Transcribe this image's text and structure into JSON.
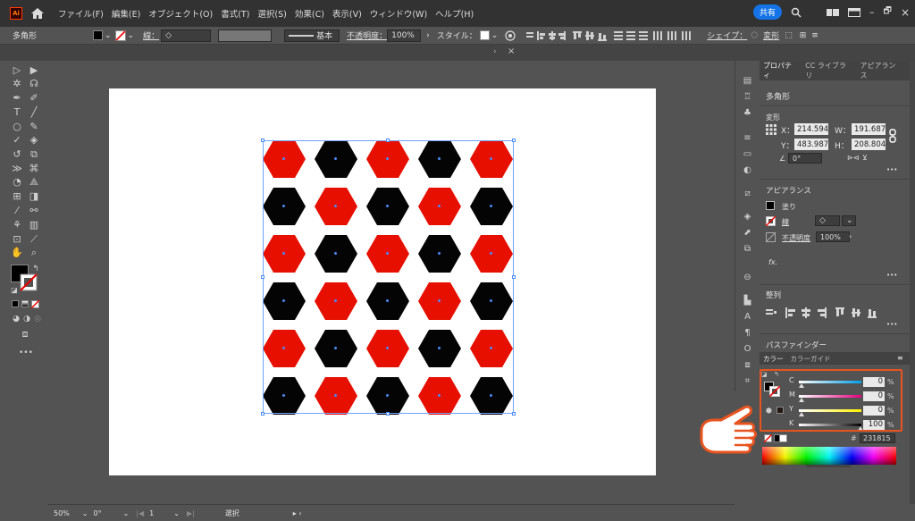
{
  "menubar": {
    "app_icon": "Ai",
    "items": [
      "ファイル(F)",
      "編集(E)",
      "オブジェクト(O)",
      "書式(T)",
      "選択(S)",
      "効果(C)",
      "表示(V)",
      "ウィンドウ(W)",
      "ヘルプ(H)"
    ],
    "share_label": "共有",
    "win_minimize": "–",
    "win_restore": "🗗",
    "win_close": "×"
  },
  "control_bar": {
    "object_type": "多角形",
    "stroke_label": "線：",
    "stroke_style": "基本",
    "opacity_label": "不透明度：",
    "opacity_value": "100%",
    "style_label": "スタイル：",
    "shape_label": "シェイプ：",
    "transform_label": "変形"
  },
  "tab_close": "×",
  "properties_panel": {
    "tabs": [
      "プロパティ",
      "CC ライブラリ",
      "アピアランス"
    ],
    "object_type": "多角形",
    "transform_heading": "変形",
    "x_label": "X：",
    "x_value": "214.594",
    "y_label": "Y：",
    "y_value": "483.987",
    "w_label": "W：",
    "w_value": "191.687",
    "h_label": "H：",
    "h_value": "208.804",
    "angle_value": "0°",
    "appearance_heading": "アピアランス",
    "fill_label": "塗り",
    "stroke_label": "線",
    "opacity_label": "不透明度",
    "opacity_value": "100%",
    "fx_label": "fx.",
    "align_heading": "整列",
    "pathfinder_heading": "パスファインダー",
    "more_dots": "•••"
  },
  "color_panel": {
    "tabs": [
      "カラー",
      "カラーガイド"
    ],
    "channels": [
      {
        "label": "C",
        "value": "0",
        "pct": "%"
      },
      {
        "label": "M",
        "value": "0",
        "pct": "%"
      },
      {
        "label": "Y",
        "value": "0",
        "pct": "%"
      },
      {
        "label": "K",
        "value": "100",
        "pct": "%"
      }
    ],
    "hex_value": "231815"
  },
  "statusbar": {
    "zoom": "50%",
    "rotation": "0°",
    "artboard_number": "1",
    "tool_name": "選択"
  },
  "pattern": {
    "rows": 6,
    "cols": 5,
    "colors": {
      "red": "#e60f00",
      "black": "#040404"
    },
    "layout": [
      [
        "red",
        "black",
        "red",
        "black",
        "red"
      ],
      [
        "black",
        "red",
        "black",
        "red",
        "black"
      ],
      [
        "red",
        "black",
        "red",
        "black",
        "red"
      ],
      [
        "black",
        "red",
        "black",
        "red",
        "black"
      ],
      [
        "red",
        "black",
        "red",
        "black",
        "red"
      ],
      [
        "black",
        "red",
        "black",
        "red",
        "black"
      ]
    ]
  },
  "colors": {
    "accent": "#1473e6",
    "highlight": "#e8541f"
  }
}
